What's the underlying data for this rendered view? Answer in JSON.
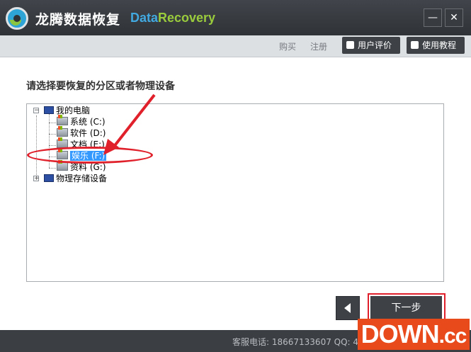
{
  "window": {
    "app_name": "龙腾数据恢复",
    "brand_part1": "Data",
    "brand_part2": "Recovery",
    "minimize_glyph": "—",
    "close_glyph": "✕"
  },
  "toolbar": {
    "buy_label": "购买",
    "register_label": "注册",
    "review_label": "用户评价",
    "guide_label": "使用教程"
  },
  "main": {
    "prompt": "请选择要恢复的分区或者物理设备",
    "tree": {
      "root_label": "我的电脑",
      "root_expander": "−",
      "drives": [
        {
          "label": "系统 (C:)"
        },
        {
          "label": "软件 (D:)"
        },
        {
          "label": "文档 (E:)"
        },
        {
          "label": "娱乐 (F:)"
        },
        {
          "label": "资料 (G:)"
        }
      ],
      "physical_label": "物理存储设备",
      "physical_expander": "+"
    }
  },
  "buttons": {
    "next_label": "下一步"
  },
  "footer": {
    "contact": "客服电话: 18667133607 QQ: 4006"
  },
  "watermark": {
    "text": "DOWN",
    "suffix": ".cc"
  },
  "colors": {
    "annotation_red": "#e0202a",
    "selection_blue": "#3399ff",
    "brand_blue": "#42a9e0",
    "brand_green": "#9acb3c"
  }
}
